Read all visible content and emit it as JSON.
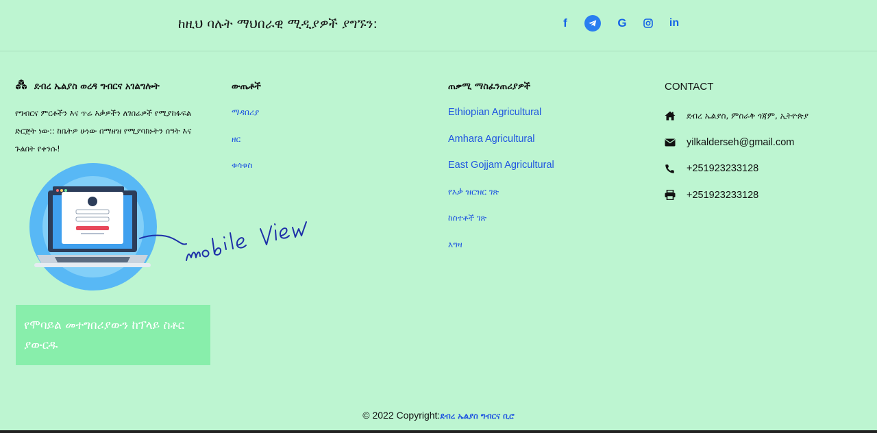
{
  "social": {
    "title": "ከዚህ ባሉት ማህበራዊ ሚዲያዎች ያግኙን:",
    "icons": [
      {
        "name": "facebook-icon",
        "glyph": "f"
      },
      {
        "name": "telegram-icon",
        "glyph": ""
      },
      {
        "name": "google-icon",
        "glyph": "G"
      },
      {
        "name": "instagram-icon",
        "glyph": ""
      },
      {
        "name": "linkedin-icon",
        "glyph": "in"
      }
    ]
  },
  "about": {
    "title": "ደብረ ኤልያስ ወረዳ ግብርና አገልግሎት",
    "text": "የግብርና ምርቶችን እና ጥሬ እቃዎችን ለገበሬዎች የሚያከፋፍል ድርጅት ነው:: ከቤትዎ ሁነው በማዘዝ የሚያባክኑትን ሰዓት እና ጉልበት የቀንሱ!",
    "illustration_caption": "mobile view",
    "store_button": "የሞባይል መተግበሪያውን ከፕላይ ስቶር ያውርዱ"
  },
  "products": {
    "title": "ውጤቶች",
    "items": [
      "ማዳበሪያ",
      "ዘር",
      "ቁሳቁስ"
    ]
  },
  "links": {
    "title": "ጠቃሚ ማስፈንጠሪያዎች",
    "items": [
      "Ethiopian Agricultural",
      "Amhara Agricultural",
      "East Gojjam Agricultural",
      "የእቃ ዝርዝር ገጽ",
      "ከስተቶች ገጽ",
      "እግዛ"
    ]
  },
  "contact": {
    "title": "CONTACT",
    "address": "ደብረ ኤልያስ, ምስራቅ ጎጃም, ኢትዮጵያ",
    "email": "yilkalderseh@gmail.com",
    "phone": "+251923233128",
    "fax": "+251923233128"
  },
  "footer": {
    "copyright": "© 2022 Copyright:",
    "org_link": "ደብረ ኤልያስ ግብርና ቢሮ"
  },
  "colors": {
    "background": "#bdf5d1",
    "link": "#1f55e0",
    "store_button_bg": "#88eeab"
  }
}
